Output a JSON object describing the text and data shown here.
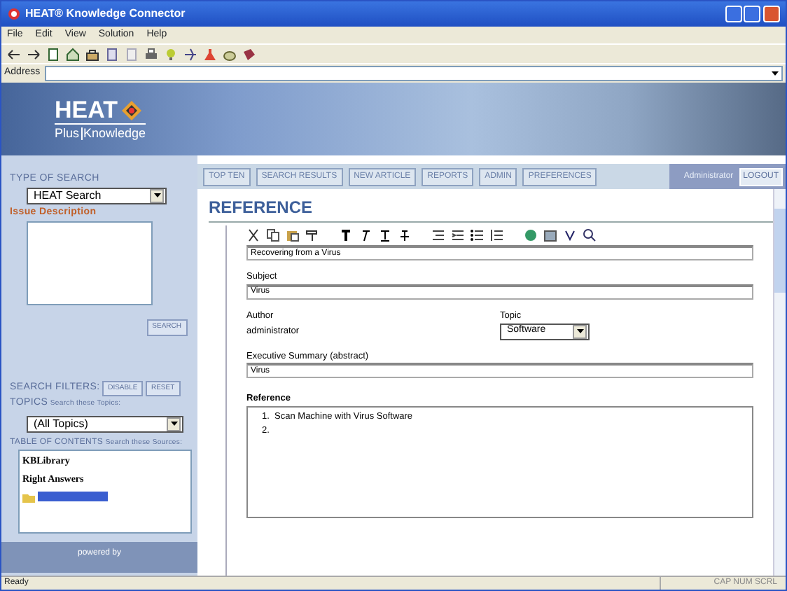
{
  "window": {
    "title": "HEAT® Knowledge Connector"
  },
  "menu": [
    "File",
    "Edit",
    "View",
    "Solution",
    "Help"
  ],
  "address": {
    "label": "Address"
  },
  "banner": {
    "brand": "HEAT",
    "tagline_1": "Plus",
    "tagline_2": "Knowledge"
  },
  "nav_tabs": [
    "TOP TEN",
    "SEARCH RESULTS",
    "NEW ARTICLE",
    "REPORTS",
    "ADMIN",
    "PREFERENCES"
  ],
  "user": {
    "name": "Administrator",
    "logout": "LOGOUT"
  },
  "sidebar": {
    "type_heading": "TYPE OF SEARCH",
    "search_type": "HEAT Search",
    "issue_label": "Issue Description",
    "search_button": "SEARCH",
    "filters_label": "SEARCH FILTERS:",
    "filter_buttons": [
      "DISABLE",
      "RESET"
    ],
    "topics_label": "TOPICS",
    "topics_hint": "Search these Topics:",
    "topic": "(All Topics)",
    "toc_label": "TABLE OF CONTENTS",
    "toc_hint": "Search these Sources:",
    "sources": [
      {
        "kind": "heading",
        "label": "KBLibrary",
        "selected": false
      },
      {
        "kind": "heading",
        "label": "Right Answers",
        "selected": false
      },
      {
        "kind": "folder",
        "selected": true
      }
    ],
    "powered_by": "powered by"
  },
  "article": {
    "heading": "REFERENCE",
    "title": "Recovering from a Virus",
    "subject_label": "Subject",
    "subject": "Virus",
    "author_label": "Author",
    "author": "administrator",
    "topic_label": "Topic",
    "topic": "Software",
    "summary_label": "Executive Summary (abstract)",
    "summary": "Virus",
    "reference_label": "Reference",
    "reference_lines": [
      "1.  Scan Machine with Virus Software",
      "2."
    ]
  },
  "status_bar": {
    "text": "Ready",
    "indicators": "CAP NUM SCRL"
  }
}
